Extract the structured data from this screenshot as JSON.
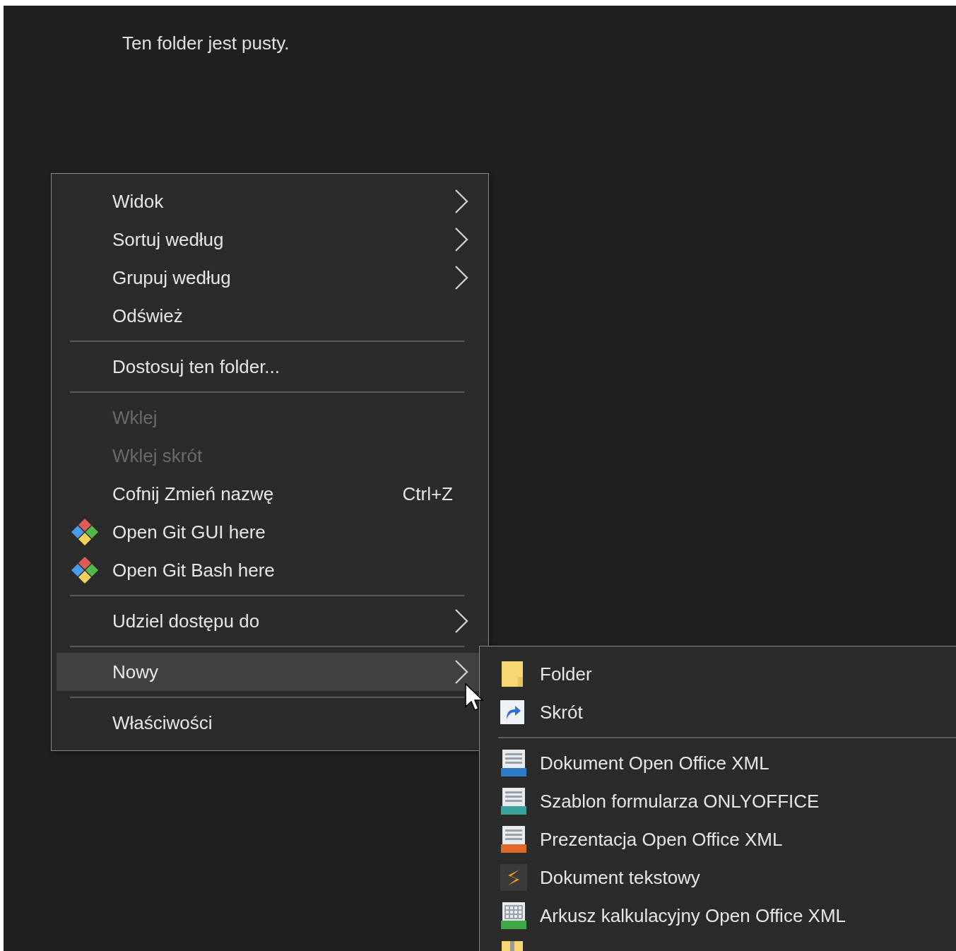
{
  "folder_view": {
    "empty_message": "Ten folder jest pusty."
  },
  "context_menu": {
    "groups": [
      [
        {
          "label": "Widok",
          "kind": "plain",
          "submenu": true,
          "disabled": false,
          "selected": false
        },
        {
          "label": "Sortuj według",
          "kind": "plain",
          "submenu": true,
          "disabled": false,
          "selected": false
        },
        {
          "label": "Grupuj według",
          "kind": "plain",
          "submenu": true,
          "disabled": false,
          "selected": false
        },
        {
          "label": "Odśwież",
          "kind": "plain",
          "submenu": false,
          "disabled": false,
          "selected": false
        }
      ],
      [
        {
          "label": "Dostosuj ten folder...",
          "kind": "plain",
          "submenu": false,
          "disabled": false,
          "selected": false
        }
      ],
      [
        {
          "label": "Wklej",
          "kind": "plain",
          "submenu": false,
          "disabled": true,
          "selected": false
        },
        {
          "label": "Wklej skrót",
          "kind": "plain",
          "submenu": false,
          "disabled": true,
          "selected": false
        },
        {
          "label": "Cofnij Zmień nazwę",
          "kind": "plain",
          "shortcut": "Ctrl+Z",
          "submenu": false,
          "disabled": false,
          "selected": false
        },
        {
          "label": "Open Git GUI here",
          "kind": "git",
          "submenu": false,
          "disabled": false,
          "selected": false
        },
        {
          "label": "Open Git Bash here",
          "kind": "git",
          "submenu": false,
          "disabled": false,
          "selected": false
        }
      ],
      [
        {
          "label": "Udziel dostępu do",
          "kind": "plain",
          "submenu": true,
          "disabled": false,
          "selected": false
        }
      ],
      [
        {
          "label": "Nowy",
          "kind": "plain",
          "submenu": true,
          "disabled": false,
          "selected": true
        }
      ],
      [
        {
          "label": "Właściwości",
          "kind": "plain",
          "submenu": false,
          "disabled": false,
          "selected": false
        }
      ]
    ]
  },
  "new_submenu": {
    "groups": [
      [
        {
          "label": "Folder",
          "kind": "folder"
        },
        {
          "label": "Skrót",
          "kind": "shortcut"
        }
      ],
      [
        {
          "label": "Dokument Open Office XML",
          "kind": "docx"
        },
        {
          "label": "Szablon formularza ONLYOFFICE",
          "kind": "docxf"
        },
        {
          "label": "Prezentacja Open Office XML",
          "kind": "pptx"
        },
        {
          "label": "Dokument tekstowy",
          "kind": "text"
        },
        {
          "label": "Arkusz kalkulacyjny Open Office XML",
          "kind": "xlsx"
        },
        {
          "kind": "zip"
        }
      ]
    ]
  }
}
